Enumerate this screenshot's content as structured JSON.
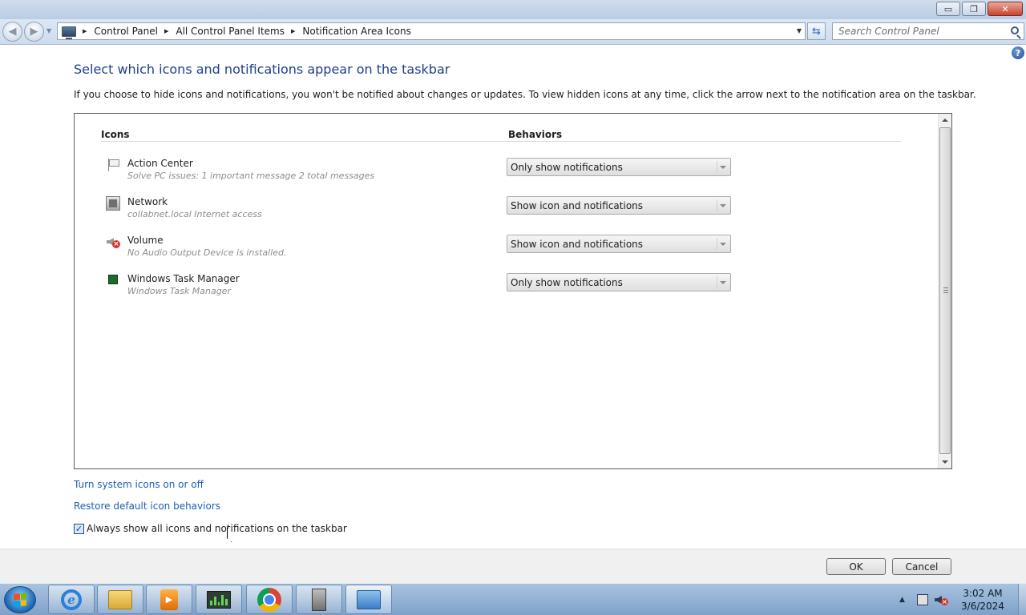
{
  "window": {
    "minimize": "▭",
    "maximize": "❐",
    "close": "✕"
  },
  "address": {
    "breadcrumbs": [
      "Control Panel",
      "All Control Panel Items",
      "Notification Area Icons"
    ],
    "search_placeholder": "Search Control Panel"
  },
  "page": {
    "heading": "Select which icons and notifications appear on the taskbar",
    "description": "If you choose to hide icons and notifications, you won't be notified about changes or updates. To view hidden icons at any time, click the arrow next to the notification area on the taskbar.",
    "col_icons": "Icons",
    "col_behaviors": "Behaviors",
    "rows": [
      {
        "name": "Action Center",
        "detail": "Solve PC issues: 1 important message  2 total messages",
        "behavior": "Only show notifications",
        "icon": "flag-icon"
      },
      {
        "name": "Network",
        "detail": "collabnet.local Internet access",
        "behavior": "Show icon and notifications",
        "icon": "network-icon"
      },
      {
        "name": "Volume",
        "detail": "No Audio Output Device is installed.",
        "behavior": "Show icon and notifications",
        "icon": "speaker-muted-icon"
      },
      {
        "name": "Windows Task Manager",
        "detail": "Windows Task Manager",
        "behavior": "Only show notifications",
        "icon": "task-manager-icon"
      }
    ],
    "link_system_icons": "Turn system icons on or off",
    "link_restore": "Restore default icon behaviors",
    "always_show_label": "Always show all icons and notifications on the taskbar",
    "always_show_checked": true,
    "ok": "OK",
    "cancel": "Cancel",
    "help": "?"
  },
  "taskbar": {
    "apps": [
      "internet-explorer-icon",
      "file-explorer-icon",
      "media-player-icon",
      "network-monitor-icon",
      "chrome-icon",
      "server-manager-icon",
      "control-panel-icon"
    ],
    "active_app": "control-panel-icon",
    "clock_time": "3:02 AM",
    "clock_date": "3/6/2024"
  }
}
